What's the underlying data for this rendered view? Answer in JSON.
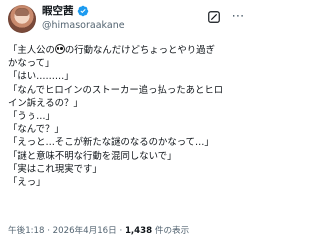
{
  "author": {
    "display_name": "暇空茜",
    "handle": "@himasoraakane",
    "verified_color": "#1d9bf0"
  },
  "header": {
    "more_icon_label": "⋯"
  },
  "tweet": {
    "line1_a": "「主人公の",
    "line1_b": "の行動なんだけどちょっとやり過ぎ",
    "line2": "かなって」",
    "line3": "「はい………」",
    "line4": "「なんでヒロインのストーカー追っ払ったあとヒロ",
    "line5": "イン訴えるの？」",
    "line6": "「うぅ…」",
    "line7": "「なんで？」",
    "line8": "「えっと…そこが新たな謎のなるのかなって…」",
    "line9": "「謎と意味不明な行動を混同しないで」",
    "line10": "「実はこれ現実です」",
    "line11": "「えっ」"
  },
  "meta": {
    "time_date": "午後1:18 · 2026年4月16日 · ",
    "views_count": "1,438",
    "views_label": " 件の表示"
  }
}
